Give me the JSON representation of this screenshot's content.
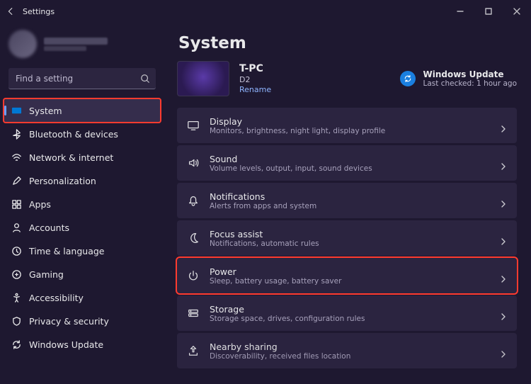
{
  "window": {
    "title": "Settings"
  },
  "search": {
    "placeholder": "Find a setting"
  },
  "sidebar": {
    "items": [
      {
        "label": "System"
      },
      {
        "label": "Bluetooth & devices"
      },
      {
        "label": "Network & internet"
      },
      {
        "label": "Personalization"
      },
      {
        "label": "Apps"
      },
      {
        "label": "Accounts"
      },
      {
        "label": "Time & language"
      },
      {
        "label": "Gaming"
      },
      {
        "label": "Accessibility"
      },
      {
        "label": "Privacy & security"
      },
      {
        "label": "Windows Update"
      }
    ]
  },
  "main": {
    "title": "System",
    "device": {
      "name": "T-PC",
      "model": "D2",
      "rename": "Rename"
    },
    "update": {
      "title": "Windows Update",
      "sub": "Last checked: 1 hour ago"
    },
    "rows": [
      {
        "title": "Display",
        "sub": "Monitors, brightness, night light, display profile"
      },
      {
        "title": "Sound",
        "sub": "Volume levels, output, input, sound devices"
      },
      {
        "title": "Notifications",
        "sub": "Alerts from apps and system"
      },
      {
        "title": "Focus assist",
        "sub": "Notifications, automatic rules"
      },
      {
        "title": "Power",
        "sub": "Sleep, battery usage, battery saver"
      },
      {
        "title": "Storage",
        "sub": "Storage space, drives, configuration rules"
      },
      {
        "title": "Nearby sharing",
        "sub": "Discoverability, received files location"
      }
    ]
  }
}
